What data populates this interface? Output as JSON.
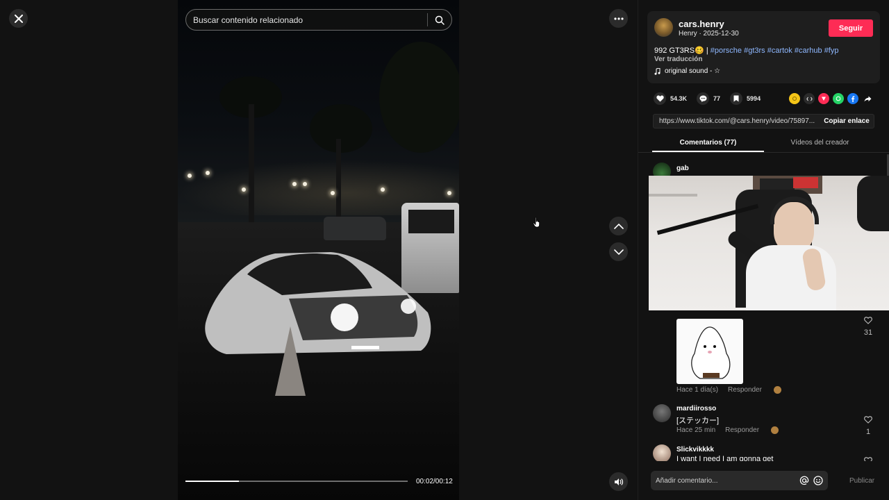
{
  "search": {
    "placeholder": "Buscar contenido relacionado"
  },
  "player": {
    "time": "00:02/00:12",
    "progress_fraction": 0.24
  },
  "author": {
    "username": "cars.henry",
    "sub": "Henry · 2025-12-30",
    "follow_label": "Seguir"
  },
  "post": {
    "caption_prefix": "992 GT3RS🥴 | ",
    "hashtags": [
      "#porsche",
      "#gt3rs",
      "#cartok",
      "#carhub",
      "#fyp"
    ],
    "translate_label": "Ver traducción",
    "sound": "original sound - ☆"
  },
  "stats": {
    "likes": "54.3K",
    "comments": "77",
    "saves": "5994"
  },
  "share": {
    "link": "https://www.tiktok.com/@cars.henry/video/75897...",
    "copy_label": "Copiar enlace"
  },
  "tabs": [
    {
      "label": "Comentarios (77)",
      "active": true
    },
    {
      "label": "Vídeos del creador",
      "active": false
    }
  ],
  "comments": [
    {
      "name": "gab",
      "text": "",
      "sticker": true,
      "time": "Hace 1 día(s)",
      "reply": "Responder",
      "likes": "31"
    },
    {
      "name": "mardiirosso",
      "text": "[ステッカー]",
      "time": "Hace 25 min",
      "reply": "Responder",
      "likes": "1"
    },
    {
      "name": "Slickvikkkk",
      "text": "I want I need I am gonna get",
      "time": "",
      "reply": "",
      "likes": ""
    }
  ],
  "composer": {
    "placeholder": "Añadir comentario...",
    "publish_label": "Publicar"
  },
  "colors": {
    "accent": "#fe2c55",
    "hashtag": "#8fb8ff",
    "background": "#121212"
  },
  "icons": [
    "close-icon",
    "search-icon",
    "more-icon",
    "chevron-up-icon",
    "chevron-down-icon",
    "volume-icon",
    "music-note-icon",
    "heart-icon",
    "comment-icon",
    "bookmark-icon",
    "at-icon",
    "emoji-icon"
  ]
}
